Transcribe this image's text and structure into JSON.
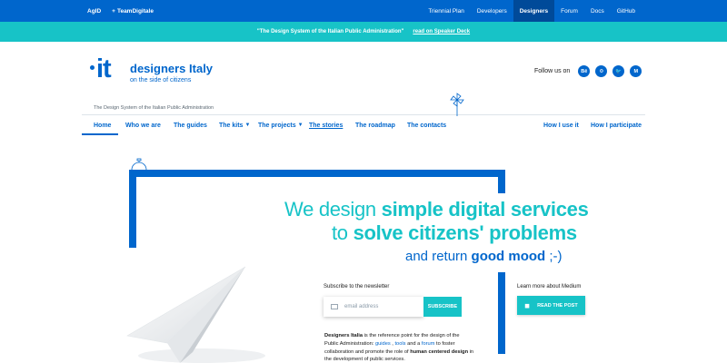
{
  "topbar": {
    "left": [
      "AgID",
      "TeamDigitale"
    ],
    "links": [
      {
        "label": "Triennial Plan",
        "active": false
      },
      {
        "label": "Developers",
        "active": false
      },
      {
        "label": "Designers",
        "active": true
      },
      {
        "label": "Forum",
        "active": false
      },
      {
        "label": "Docs",
        "active": false
      },
      {
        "label": "GitHub",
        "active": false
      }
    ]
  },
  "announcement": {
    "text": "\"The Design System of the Italian Public Administration\"",
    "link": "read on Speaker Deck"
  },
  "header": {
    "logo_mark": "it",
    "title": "designers Italy",
    "subtitle": "on the side of citizens",
    "tagline": "The Design System of the Italian Public Administration",
    "follow_label": "Follow us on",
    "social": [
      "Bē",
      "⚙",
      "🐦",
      "M"
    ]
  },
  "nav": {
    "items": [
      {
        "label": "Home",
        "active": true
      },
      {
        "label": "Who we are"
      },
      {
        "label": "The guides"
      },
      {
        "label": "The kits",
        "dropdown": true
      },
      {
        "label": "The projects",
        "dropdown": true
      },
      {
        "label": "The stories"
      },
      {
        "label": "The roadmap"
      },
      {
        "label": "The contacts"
      }
    ],
    "right": [
      "How I use it",
      "How I participate"
    ]
  },
  "hero": {
    "line1_a": "We design ",
    "line1_b": "simple digital services",
    "line2_a": "to ",
    "line2_b": "solve citizens' problems",
    "line3_a": "and return ",
    "line3_b": "good mood",
    "line3_c": " ;-)"
  },
  "newsletter": {
    "label": "Subscribe to the newsletter",
    "placeholder": "email address",
    "button": "SUBSCRIBE"
  },
  "medium": {
    "label": "Learn more about Medium",
    "button": "READ THE POST"
  },
  "about": {
    "bold1": "Designers Italia",
    "t1": " is the reference point for the design of the Public Administration: ",
    "link1": "guides",
    "t2": " , ",
    "link2": "tools",
    "t3": " and a ",
    "link3": "forum",
    "t4": " to foster collaboration and promote the role of ",
    "bold2": "human centered design",
    "t5": " in the development of public services."
  },
  "colors": {
    "primary_blue": "#0066cc",
    "teal": "#17c3c7"
  }
}
